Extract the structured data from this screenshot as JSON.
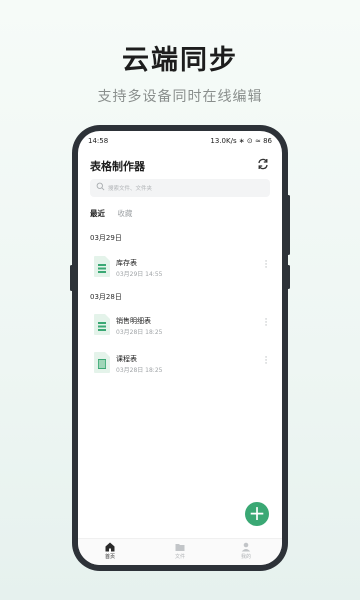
{
  "hero": {
    "title": "云端同步",
    "subtitle": "支持多设备同时在线编辑"
  },
  "status_bar": {
    "time": "14:58",
    "indicators": "13.0K/s ∗ ⊙ ≈ 86"
  },
  "header": {
    "title": "表格制作器",
    "sync_icon": "sync-icon"
  },
  "search": {
    "placeholder": "搜索文件、文件夹"
  },
  "tabs": [
    {
      "label": "最近",
      "active": true
    },
    {
      "label": "收藏",
      "active": false
    }
  ],
  "sections": [
    {
      "date": "03月29日",
      "files": [
        {
          "name": "库存表",
          "meta": "03月29日 14:55"
        }
      ]
    },
    {
      "date": "03月28日",
      "files": [
        {
          "name": "销售明细表",
          "meta": "03月28日 18:25"
        },
        {
          "name": "课程表",
          "meta": "03月28日 18:25"
        }
      ]
    }
  ],
  "fab": {
    "label": "+"
  },
  "bottom_nav": [
    {
      "label": "首页",
      "icon": "home-icon",
      "active": true
    },
    {
      "label": "文件",
      "icon": "folder-icon",
      "active": false
    },
    {
      "label": "我的",
      "icon": "person-icon",
      "active": false
    }
  ],
  "colors": {
    "accent": "#3aa874",
    "phone_frame": "#2d3238"
  }
}
